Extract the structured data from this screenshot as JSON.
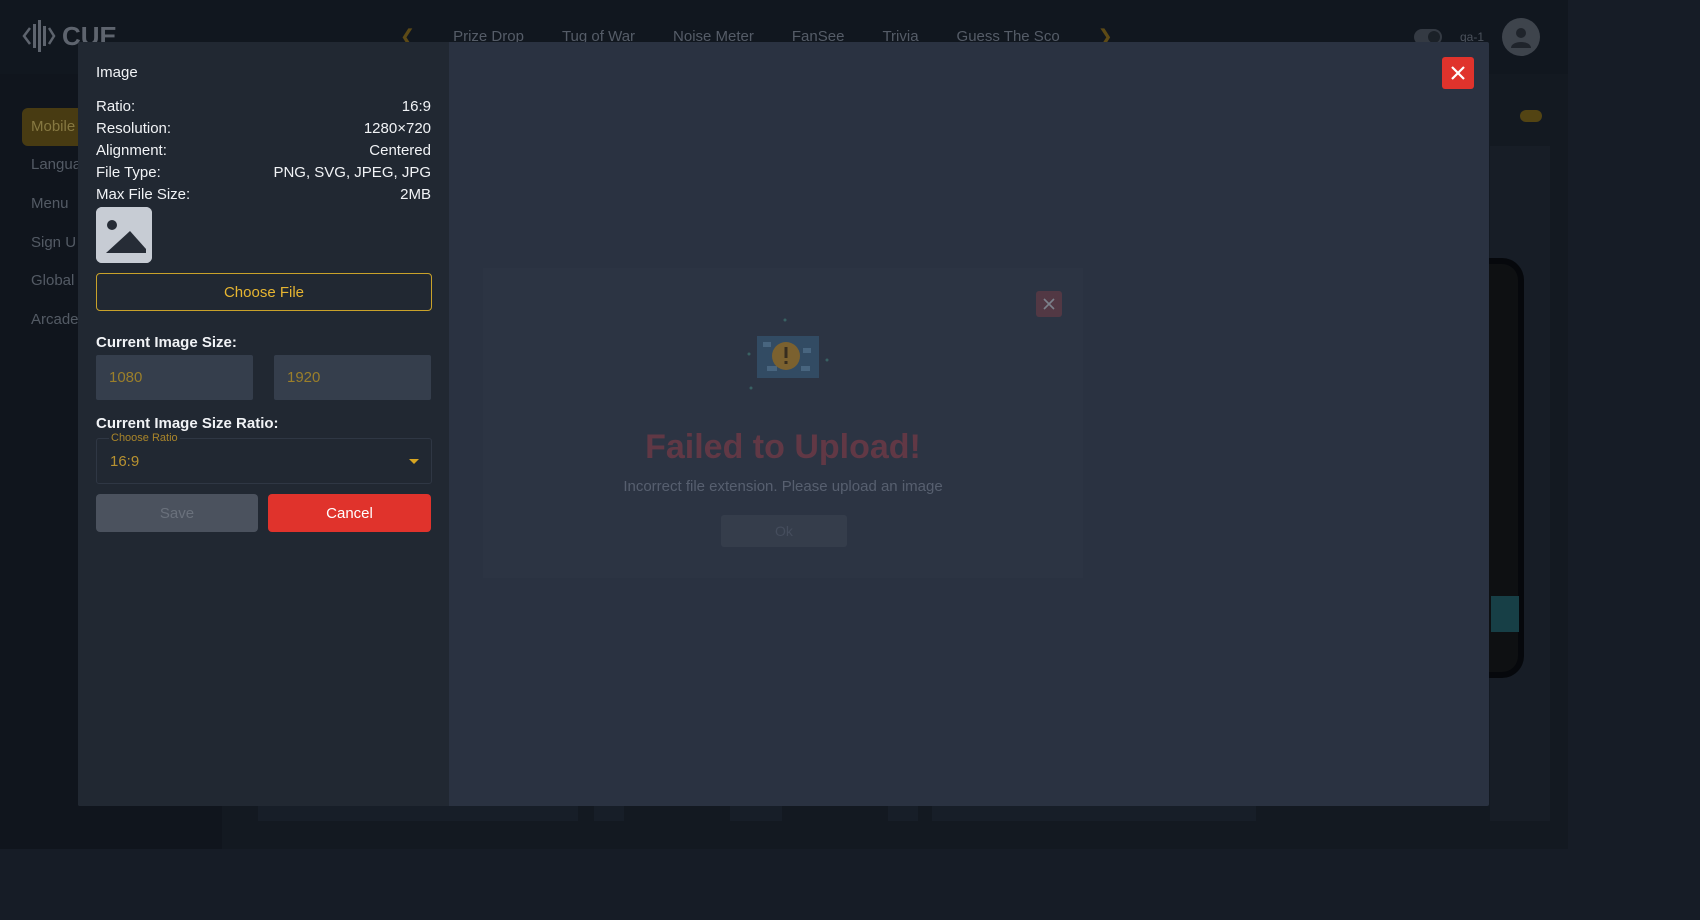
{
  "app": {
    "logo_text": "CUE",
    "nav_tabs": [
      "Prize Drop",
      "Tug of War",
      "Noise Meter",
      "FanSee",
      "Trivia",
      "Guess The Sco"
    ],
    "user_name": "qa-1"
  },
  "sidebar": {
    "items": [
      {
        "label": "Mobile"
      },
      {
        "label": "Langua"
      },
      {
        "label": "Menu"
      },
      {
        "label": "Sign U"
      },
      {
        "label": "Global"
      },
      {
        "label": "Arcade"
      }
    ]
  },
  "modal": {
    "title": "Image",
    "specs": [
      {
        "label": "Ratio:",
        "value": "16:9"
      },
      {
        "label": "Resolution:",
        "value": "1280×720"
      },
      {
        "label": "Alignment:",
        "value": "Centered"
      },
      {
        "label": "File Type:",
        "value": "PNG, SVG, JPEG, JPG"
      },
      {
        "label": "Max File Size:",
        "value": "2MB"
      }
    ],
    "choose_file_label": "Choose File",
    "current_size_label": "Current Image Size:",
    "size_inputs": {
      "height_placeholder": "1080",
      "width_placeholder": "1920"
    },
    "ratio_label": "Current Image Size Ratio:",
    "ratio_select": {
      "legend": "Choose Ratio",
      "value": "16:9"
    },
    "save_label": "Save",
    "cancel_label": "Cancel"
  },
  "error_dialog": {
    "title": "Failed to Upload!",
    "message": "Incorrect file extension. Please upload an image",
    "ok_label": "Ok"
  },
  "colors": {
    "accent": "#e6b531",
    "danger": "#e0332c",
    "modal_bg": "#2a3241",
    "pane_bg": "#212832"
  }
}
